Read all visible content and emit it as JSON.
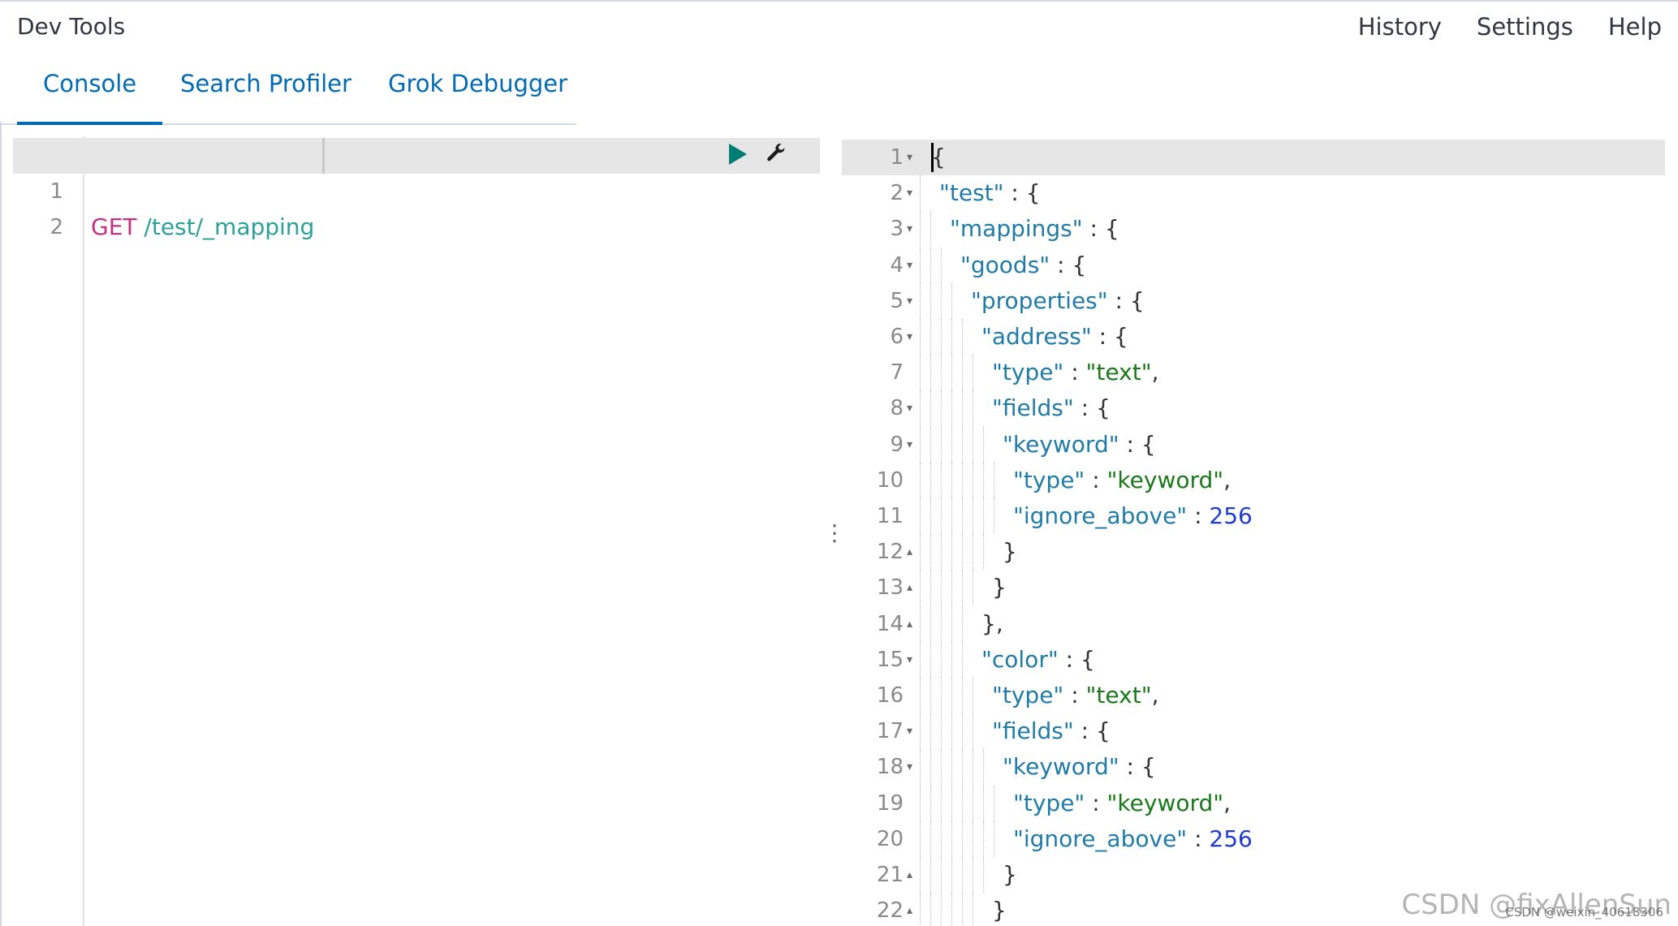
{
  "app": {
    "title": "Dev Tools"
  },
  "top_menu": [
    "History",
    "Settings",
    "Help"
  ],
  "tabs": [
    {
      "label": "Console",
      "active": true
    },
    {
      "label": "Search Profiler",
      "active": false
    },
    {
      "label": "Grok Debugger",
      "active": false
    }
  ],
  "request_editor": {
    "line_numbers": [
      "1",
      "2"
    ],
    "method": "GET",
    "path": "/test/_mapping",
    "icons": [
      "play-icon",
      "wrench-icon"
    ]
  },
  "response_editor": {
    "lines": [
      {
        "n": "1",
        "fold": "▾",
        "tokens": [
          [
            "p",
            "{"
          ]
        ]
      },
      {
        "n": "2",
        "fold": "▾",
        "tokens": [
          [
            "k",
            "\"test\""
          ],
          [
            "p",
            " : {"
          ]
        ]
      },
      {
        "n": "3",
        "fold": "▾",
        "tokens": [
          [
            "k",
            "\"mappings\""
          ],
          [
            "p",
            " : {"
          ]
        ]
      },
      {
        "n": "4",
        "fold": "▾",
        "tokens": [
          [
            "k",
            "\"goods\""
          ],
          [
            "p",
            " : {"
          ]
        ]
      },
      {
        "n": "5",
        "fold": "▾",
        "tokens": [
          [
            "k",
            "\"properties\""
          ],
          [
            "p",
            " : {"
          ]
        ]
      },
      {
        "n": "6",
        "fold": "▾",
        "tokens": [
          [
            "k",
            "\"address\""
          ],
          [
            "p",
            " : {"
          ]
        ]
      },
      {
        "n": "7",
        "fold": "",
        "tokens": [
          [
            "k",
            "\"type\""
          ],
          [
            "p",
            " : "
          ],
          [
            "s",
            "\"text\""
          ],
          [
            "p",
            ","
          ]
        ]
      },
      {
        "n": "8",
        "fold": "▾",
        "tokens": [
          [
            "k",
            "\"fields\""
          ],
          [
            "p",
            " : {"
          ]
        ]
      },
      {
        "n": "9",
        "fold": "▾",
        "tokens": [
          [
            "k",
            "\"keyword\""
          ],
          [
            "p",
            " : {"
          ]
        ]
      },
      {
        "n": "10",
        "fold": "",
        "tokens": [
          [
            "k",
            "\"type\""
          ],
          [
            "p",
            " : "
          ],
          [
            "s",
            "\"keyword\""
          ],
          [
            "p",
            ","
          ]
        ]
      },
      {
        "n": "11",
        "fold": "",
        "tokens": [
          [
            "k",
            "\"ignore_above\""
          ],
          [
            "p",
            " : "
          ],
          [
            "n",
            "256"
          ]
        ]
      },
      {
        "n": "12",
        "fold": "▴",
        "tokens": [
          [
            "p",
            "}"
          ]
        ]
      },
      {
        "n": "13",
        "fold": "▴",
        "tokens": [
          [
            "p",
            "}"
          ]
        ]
      },
      {
        "n": "14",
        "fold": "▴",
        "tokens": [
          [
            "p",
            "},"
          ]
        ]
      },
      {
        "n": "15",
        "fold": "▾",
        "tokens": [
          [
            "k",
            "\"color\""
          ],
          [
            "p",
            " : {"
          ]
        ]
      },
      {
        "n": "16",
        "fold": "",
        "tokens": [
          [
            "k",
            "\"type\""
          ],
          [
            "p",
            " : "
          ],
          [
            "s",
            "\"text\""
          ],
          [
            "p",
            ","
          ]
        ]
      },
      {
        "n": "17",
        "fold": "▾",
        "tokens": [
          [
            "k",
            "\"fields\""
          ],
          [
            "p",
            " : {"
          ]
        ]
      },
      {
        "n": "18",
        "fold": "▾",
        "tokens": [
          [
            "k",
            "\"keyword\""
          ],
          [
            "p",
            " : {"
          ]
        ]
      },
      {
        "n": "19",
        "fold": "",
        "tokens": [
          [
            "k",
            "\"type\""
          ],
          [
            "p",
            " : "
          ],
          [
            "s",
            "\"keyword\""
          ],
          [
            "p",
            ","
          ]
        ]
      },
      {
        "n": "20",
        "fold": "",
        "tokens": [
          [
            "k",
            "\"ignore_above\""
          ],
          [
            "p",
            " : "
          ],
          [
            "n",
            "256"
          ]
        ]
      },
      {
        "n": "21",
        "fold": "▴",
        "tokens": [
          [
            "p",
            "}"
          ]
        ]
      },
      {
        "n": "22",
        "fold": "▴",
        "tokens": [
          [
            "p",
            "}"
          ]
        ]
      }
    ]
  },
  "resizer": {
    "glyph": "⋮"
  },
  "watermark": {
    "main": "CSDN @fixAllenSun",
    "sub": "CSDN @weixin_40618306"
  },
  "colors": {
    "accent": "#006bb4",
    "method": "#c4307f",
    "url": "#2aa198",
    "key": "#1f7ba8",
    "string": "#1a7a1a",
    "number": "#1f3bd1",
    "run": "#017d73"
  }
}
